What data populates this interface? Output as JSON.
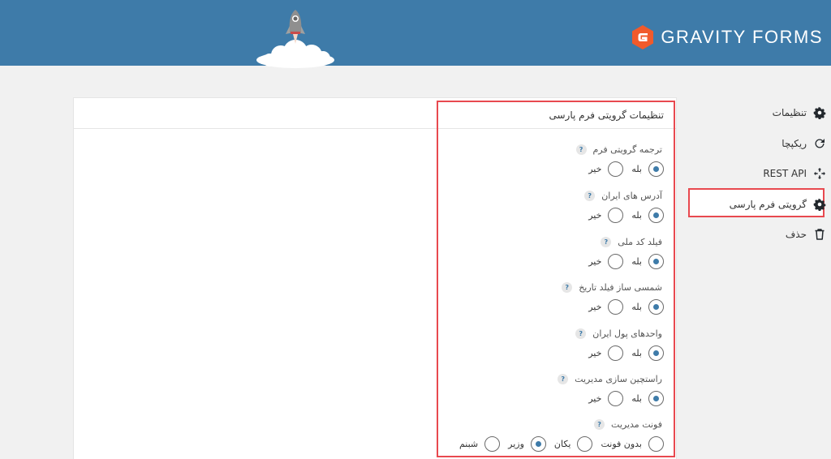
{
  "header": {
    "brand": "GRAVITY FORMS"
  },
  "panel": {
    "title": "تنظیمات گرویتی فرم پارسی",
    "help_glyph": "?",
    "fields": [
      {
        "label": "ترجمه گرویتی فرم",
        "options": [
          {
            "label": "بله",
            "checked": true
          },
          {
            "label": "خیر",
            "checked": false
          }
        ]
      },
      {
        "label": "آدرس های ایران",
        "options": [
          {
            "label": "بله",
            "checked": true
          },
          {
            "label": "خیر",
            "checked": false
          }
        ]
      },
      {
        "label": "فیلد کد ملی",
        "options": [
          {
            "label": "بله",
            "checked": true
          },
          {
            "label": "خیر",
            "checked": false
          }
        ]
      },
      {
        "label": "شمسی ساز فیلد تاریخ",
        "options": [
          {
            "label": "بله",
            "checked": true
          },
          {
            "label": "خیر",
            "checked": false
          }
        ]
      },
      {
        "label": "واحدهای پول ایران",
        "options": [
          {
            "label": "بله",
            "checked": true
          },
          {
            "label": "خیر",
            "checked": false
          }
        ]
      },
      {
        "label": "راستچین سازی مدیریت",
        "options": [
          {
            "label": "بله",
            "checked": true
          },
          {
            "label": "خیر",
            "checked": false
          }
        ]
      },
      {
        "label": "فونت مدیریت",
        "options": [
          {
            "label": "بدون فونت",
            "checked": false
          },
          {
            "label": "یکان",
            "checked": false
          },
          {
            "label": "وزیر",
            "checked": true
          },
          {
            "label": "شبنم",
            "checked": false
          }
        ]
      }
    ]
  },
  "sidebar": {
    "items": [
      {
        "label": "تنظیمات",
        "icon": "gear-icon"
      },
      {
        "label": "ریکپچا",
        "icon": "recaptcha-icon"
      },
      {
        "label": "REST API",
        "icon": "api-icon"
      },
      {
        "label": "گرویتی فرم پارسی",
        "icon": "gear-icon",
        "active": true
      },
      {
        "label": "حذف",
        "icon": "trash-icon"
      }
    ]
  },
  "colors": {
    "header_bg": "#3e7ba9",
    "accent": "#3e7ba9",
    "highlight": "#e8494f",
    "logo_orange": "#f15a2b"
  }
}
